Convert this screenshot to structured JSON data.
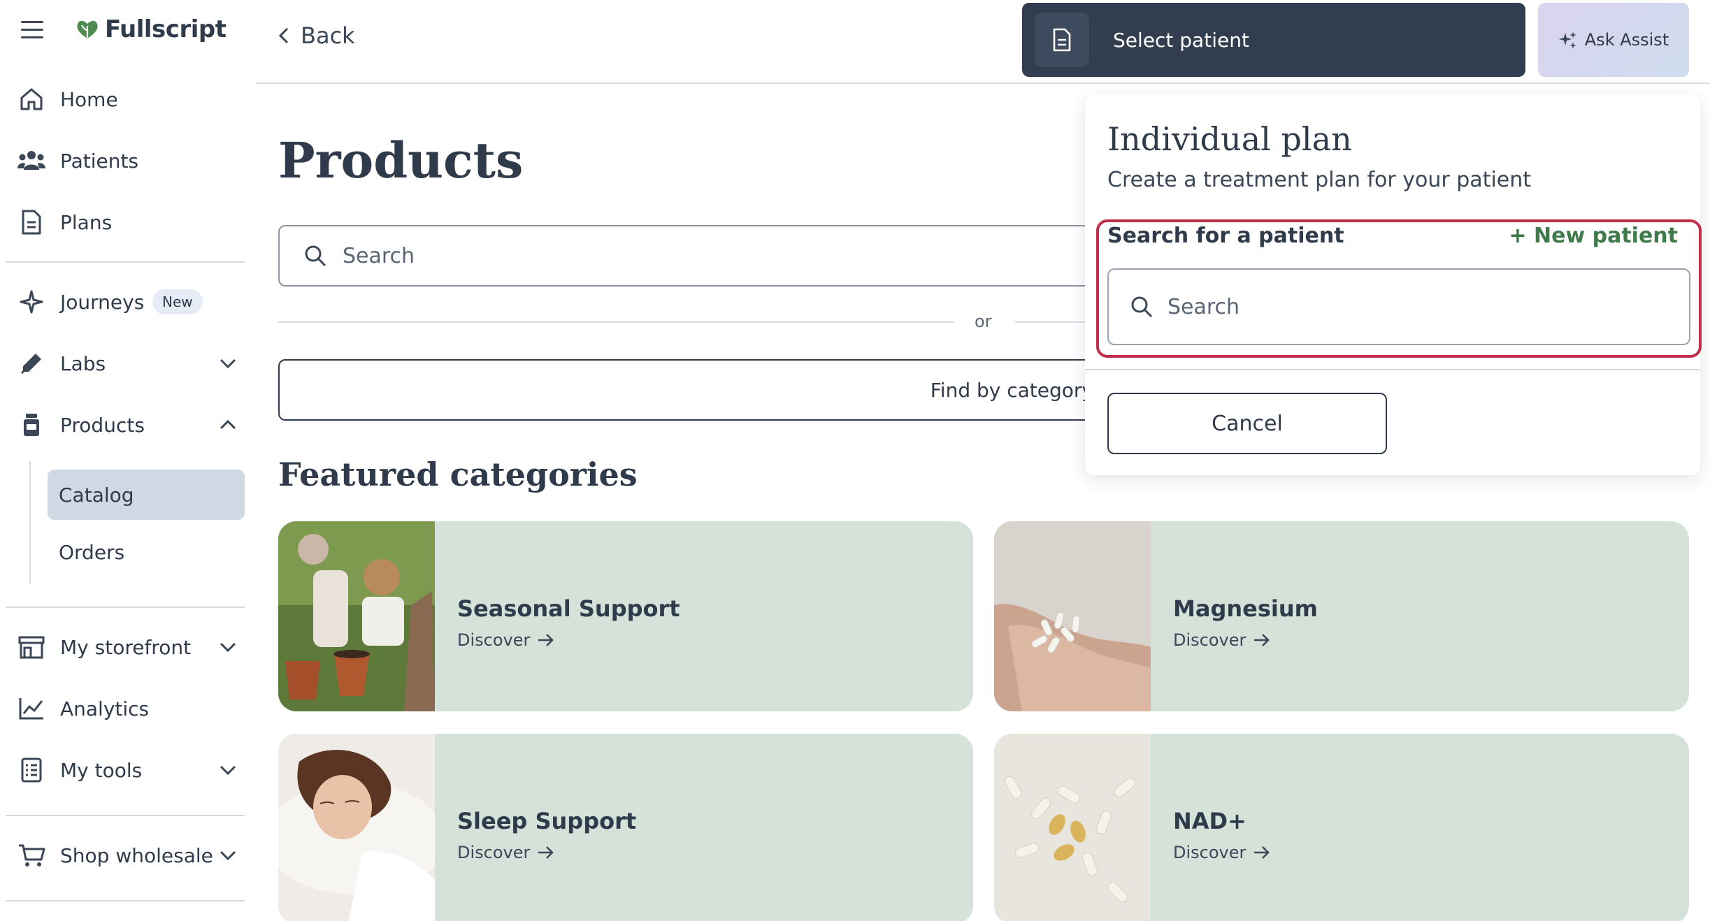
{
  "brand": {
    "name": "Fullscript",
    "accent": "#3e7a4a"
  },
  "sidebar": {
    "items": [
      {
        "label": "Home",
        "icon": "home-icon"
      },
      {
        "label": "Patients",
        "icon": "patients-icon"
      },
      {
        "label": "Plans",
        "icon": "document-icon"
      },
      {
        "label": "Journeys",
        "icon": "sparkle-icon",
        "badge": "New"
      },
      {
        "label": "Labs",
        "icon": "pipette-icon"
      },
      {
        "label": "Products",
        "icon": "bottle-icon"
      },
      {
        "label": "My storefront",
        "icon": "storefront-icon"
      },
      {
        "label": "Analytics",
        "icon": "chart-line-icon"
      },
      {
        "label": "My tools",
        "icon": "checklist-icon"
      },
      {
        "label": "Shop wholesale",
        "icon": "cart-icon"
      }
    ],
    "products_sub": [
      {
        "label": "Catalog",
        "active": true
      },
      {
        "label": "Orders",
        "active": false
      }
    ]
  },
  "header": {
    "back_label": "Back",
    "select_patient_label": "Select patient",
    "ask_assist_label": "Ask Assist"
  },
  "main": {
    "title": "Products",
    "search_placeholder": "Search",
    "or_label": "or",
    "find_category_label": "Find by category",
    "featured_title": "Featured categories",
    "categories": [
      {
        "name": "Seasonal Support",
        "cta": "Discover"
      },
      {
        "name": "Magnesium",
        "cta": "Discover"
      },
      {
        "name": "Sleep Support",
        "cta": "Discover"
      },
      {
        "name": "NAD+",
        "cta": "Discover"
      }
    ]
  },
  "popover": {
    "title": "Individual plan",
    "subtitle": "Create a treatment plan for your patient",
    "search_label": "Search for a patient",
    "new_patient_label": "+ New patient",
    "search_placeholder": "Search",
    "cancel_label": "Cancel",
    "highlight_color": "#c0304a"
  }
}
